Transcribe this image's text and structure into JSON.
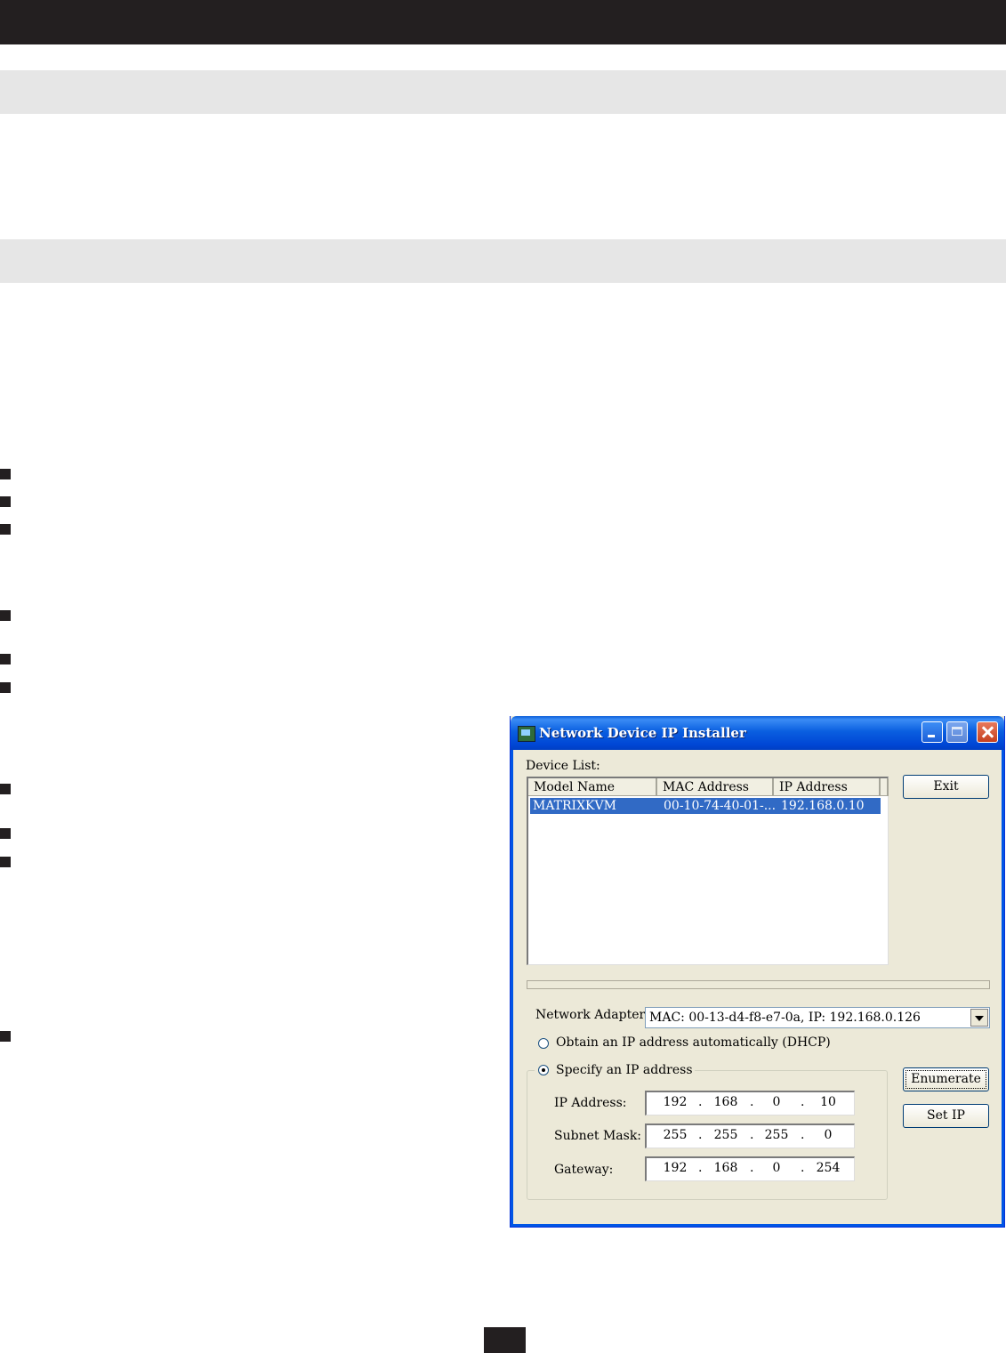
{
  "window": {
    "title": "Network Device IP Installer",
    "device_list_label": "Device List:",
    "columns": [
      "Model Name",
      "MAC Address",
      "IP Address"
    ],
    "rows": [
      {
        "model": "MATRIXKVM",
        "mac": "00-10-74-40-01-...",
        "ip": "192.168.0.10",
        "selected": true
      }
    ],
    "buttons": {
      "exit": "Exit",
      "enumerate": "Enumerate",
      "set_ip": "Set IP"
    },
    "network_adapter_label": "Network Adapter:",
    "network_adapter_value": "MAC: 00-13-d4-f8-e7-0a,  IP: 192.168.0.126",
    "dhcp_label": "Obtain an IP address automatically (DHCP)",
    "dhcp_selected": false,
    "specify_label": "Specify an IP address",
    "specify_selected": true,
    "ip_address_label": "IP Address:",
    "ip_address": [
      "192",
      "168",
      "0",
      "10"
    ],
    "subnet_mask_label": "Subnet Mask:",
    "subnet_mask": [
      "255",
      "255",
      "255",
      "0"
    ],
    "gateway_label": "Gateway:",
    "gateway": [
      "192",
      "168",
      "0",
      "254"
    ]
  },
  "colors": {
    "dark_bar": "#231f20",
    "band": "#e6e6e6",
    "selection": "#316ac5",
    "titlebar": "#0a5fe0"
  }
}
